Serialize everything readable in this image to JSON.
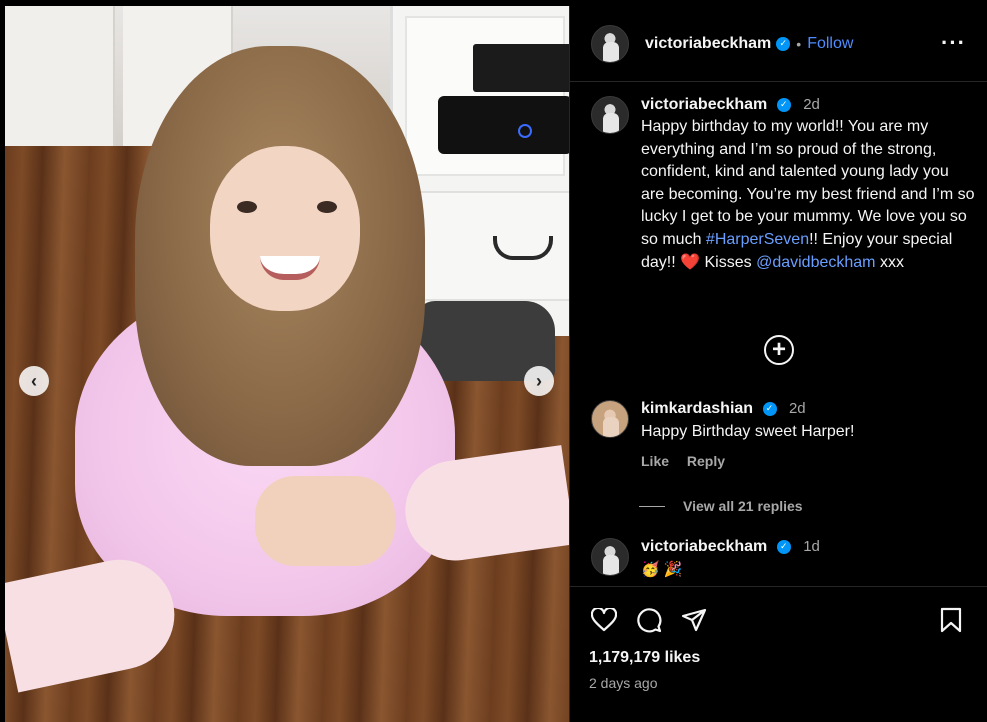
{
  "header": {
    "username": "victoriabeckham",
    "separator": "•",
    "follow_label": "Follow",
    "more_label": "···"
  },
  "caption": {
    "username": "victoriabeckham",
    "time": "2d",
    "text_1": "Happy birthday to my world!! You are my everything and I’m so proud of the strong, confident, kind and talented young lady you are becoming. You’re my best friend and I’m so lucky I get to be your mummy. We love you so so much ",
    "hashtag": "#HarperSeven",
    "text_2": "!! Enjoy your special day!! ",
    "heart_emoji": "❤️",
    "text_3": " Kisses ",
    "mention": "@davidbeckham",
    "text_4": " xxx"
  },
  "load_more_label": "+",
  "comments": [
    {
      "username": "kimkardashian",
      "time": "2d",
      "text": "Happy Birthday sweet Harper!",
      "like_label": "Like",
      "reply_label": "Reply",
      "view_replies_label": "View all 21 replies"
    },
    {
      "username": "victoriabeckham",
      "time": "1d",
      "emojis": "🥳 🎉"
    }
  ],
  "media_nav": {
    "prev": "‹",
    "next": "›"
  },
  "footer": {
    "likes": "1,179,179 likes",
    "posted": "2 days ago"
  },
  "icons": {
    "like": "heart-icon",
    "comment": "comment-icon",
    "share": "share-icon",
    "save": "bookmark-icon",
    "verified": "verified-badge-icon"
  },
  "colors": {
    "background": "#000000",
    "link": "#6a9fff",
    "follow": "#4d8dff",
    "verified": "#0095f6",
    "muted": "#a8a8a8"
  }
}
